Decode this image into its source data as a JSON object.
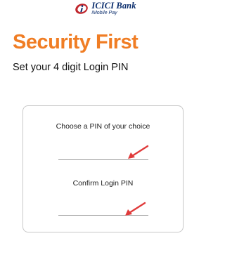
{
  "header": {
    "brand_name": "ICICI Bank",
    "brand_sub": "iMobile Pay",
    "logo_icon": "icici-logo-mark",
    "brand_color": "#0d2f6e",
    "accent_color": "#c0262d"
  },
  "page": {
    "title": "Security First",
    "title_color": "#f07d24",
    "subtitle": "Set your 4 digit Login PIN"
  },
  "pin_form": {
    "choose_label": "Choose a PIN of your choice",
    "choose_value": "",
    "confirm_label": "Confirm Login PIN",
    "confirm_value": "",
    "annotation_icon": "red-arrow-icon",
    "annotation_color": "#e03a3a"
  }
}
